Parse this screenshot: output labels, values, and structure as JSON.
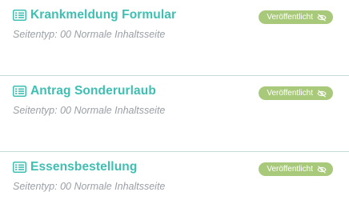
{
  "colors": {
    "title": "#3ebfb2",
    "subtitle": "#9aa0a6",
    "badge_bg": "#a9c97a",
    "divider": "#c6d8db"
  },
  "pages": [
    {
      "icon": "list-icon",
      "title": "Krankmeldung Formular",
      "subtitle": "Seitentyp: 00 Normale Inhaltsseite",
      "status": "Veröffentlicht",
      "status_icon": "eye-slash-icon"
    },
    {
      "icon": "list-icon",
      "title": "Antrag Sonderurlaub",
      "subtitle": "Seitentyp: 00 Normale Inhaltsseite",
      "status": "Veröffentlicht",
      "status_icon": "eye-slash-icon"
    },
    {
      "icon": "list-icon",
      "title": "Essensbestellung",
      "subtitle": "Seitentyp: 00 Normale Inhaltsseite",
      "status": "Veröffentlicht",
      "status_icon": "eye-slash-icon"
    }
  ]
}
